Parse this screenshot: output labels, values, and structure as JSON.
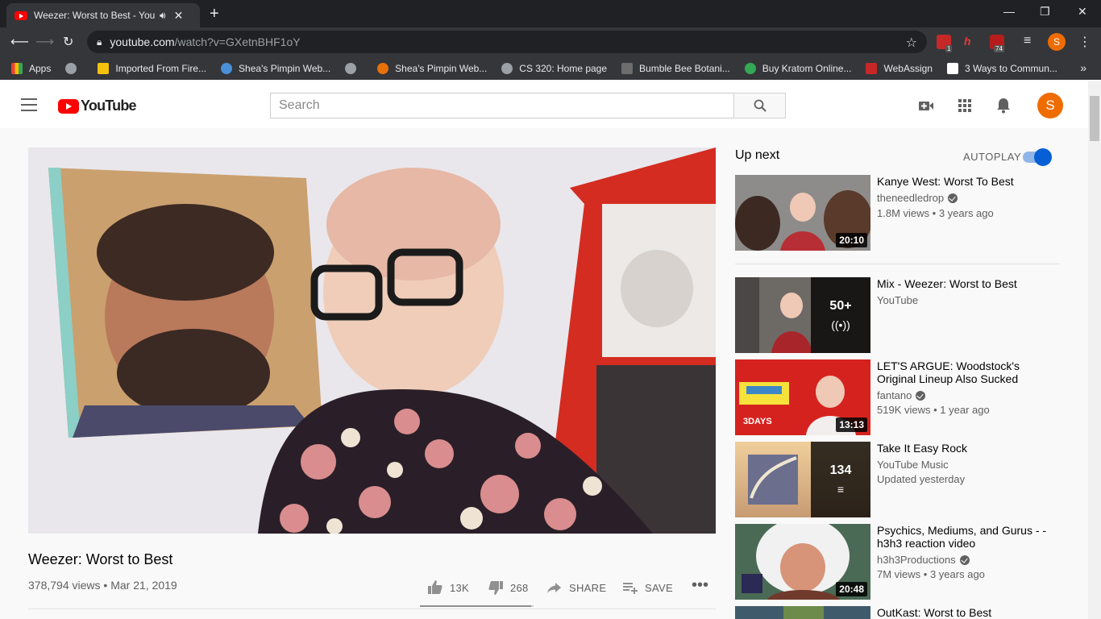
{
  "browser": {
    "tab_title": "Weezer: Worst to Best - YouT",
    "tab_audio_icon": "speaker-icon",
    "url_domain": "youtube.com",
    "url_path": "/watch?v=GXetnBHF1oY",
    "profile_initial": "S",
    "ext_badge_1": "1",
    "ext_badge_2": "74",
    "bookmarks": [
      {
        "label": "Apps",
        "color": "#ea4335"
      },
      {
        "label": "",
        "color": "#9aa0a6"
      },
      {
        "label": "Imported From Fire...",
        "color": "#f4c20d"
      },
      {
        "label": "Shea's Pimpin Web...",
        "color": "#4a90d9"
      },
      {
        "label": "",
        "color": "#9aa0a6"
      },
      {
        "label": "Shea's Pimpin Web...",
        "color": "#e8710a"
      },
      {
        "label": "CS 320: Home page",
        "color": "#9aa0a6"
      },
      {
        "label": "Bumble Bee Botani...",
        "color": "#6d6d6d"
      },
      {
        "label": "Buy Kratom Online...",
        "color": "#34a853"
      },
      {
        "label": "WebAssign",
        "color": "#c62828"
      },
      {
        "label": "3 Ways to Commun...",
        "color": "#ffffff"
      }
    ]
  },
  "youtube": {
    "logo_text": "YouTube",
    "search_placeholder": "Search",
    "avatar_initial": "S"
  },
  "video": {
    "title": "Weezer: Worst to Best",
    "views": "378,794 views",
    "date": "Mar 21, 2019",
    "likes": "13K",
    "dislikes": "268",
    "share_label": "SHARE",
    "save_label": "SAVE",
    "like_ratio": 0.98
  },
  "sidebar": {
    "up_next": "Up next",
    "autoplay": "AUTOPLAY",
    "autoplay_on": true,
    "items": [
      {
        "title": "Kanye West: Worst To Best",
        "channel": "theneedledrop",
        "verified": true,
        "views": "1.8M views",
        "age": "3 years ago",
        "duration": "20:10"
      },
      {
        "title": "Mix - Weezer: Worst to Best",
        "channel": "YouTube",
        "verified": false,
        "overlay_count": "50+"
      },
      {
        "title": "LET'S ARGUE: Woodstock's Original Lineup Also Sucked",
        "channel": "fantano",
        "verified": true,
        "views": "519K views",
        "age": "1 year ago",
        "duration": "13:13"
      },
      {
        "title": "Take It Easy Rock",
        "channel": "YouTube Music",
        "verified": false,
        "meta": "Updated yesterday",
        "overlay_count": "134"
      },
      {
        "title": "Psychics, Mediums, and Gurus - - h3h3 reaction video",
        "channel": "h3h3Productions",
        "verified": true,
        "views": "7M views",
        "age": "3 years ago",
        "duration": "20:48"
      },
      {
        "title": "OutKast: Worst to Best"
      }
    ]
  }
}
